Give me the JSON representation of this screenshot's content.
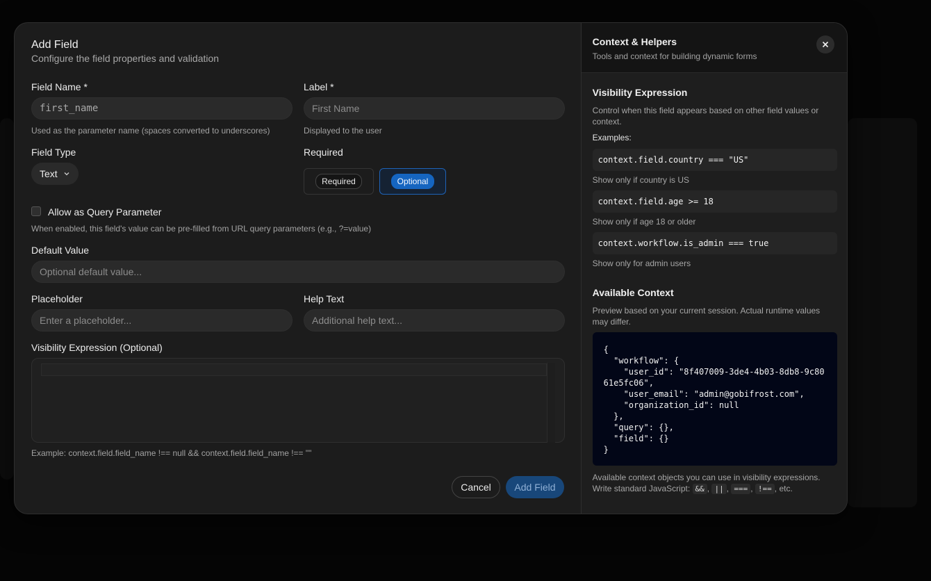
{
  "form": {
    "title": "Add Field",
    "subtitle": "Configure the field properties and validation",
    "field_name": {
      "label": "Field Name *",
      "value": "first_name",
      "hint": "Used as the parameter name (spaces converted to underscores)"
    },
    "label_field": {
      "label": "Label *",
      "placeholder": "First Name",
      "hint": "Displayed to the user"
    },
    "field_type": {
      "label": "Field Type",
      "value": "Text"
    },
    "required": {
      "label": "Required",
      "options": [
        "Required",
        "Optional"
      ],
      "selected": "Optional"
    },
    "query_param": {
      "label": "Allow as Query Parameter",
      "checked": false,
      "hint": "When enabled, this field's value can be pre-filled from URL query parameters (e.g., ?=value)"
    },
    "default_value": {
      "label": "Default Value",
      "placeholder": "Optional default value..."
    },
    "placeholder_field": {
      "label": "Placeholder",
      "placeholder": "Enter a placeholder..."
    },
    "help_text": {
      "label": "Help Text",
      "placeholder": "Additional help text..."
    },
    "visibility": {
      "label": "Visibility Expression (Optional)",
      "example": "Example: context.field.field_name !== null && context.field.field_name !== \"\""
    },
    "buttons": {
      "cancel": "Cancel",
      "submit": "Add Field"
    }
  },
  "helpers": {
    "title": "Context & Helpers",
    "subtitle": "Tools and context for building dynamic forms",
    "visibility": {
      "title": "Visibility Expression",
      "description": "Control when this field appears based on other field values or context.",
      "examples_label": "Examples:",
      "examples": [
        {
          "code": "context.field.country === \"US\"",
          "caption": "Show only if country is US"
        },
        {
          "code": "context.field.age >= 18",
          "caption": "Show only if age 18 or older"
        },
        {
          "code": "context.workflow.is_admin === true",
          "caption": "Show only for admin users"
        }
      ]
    },
    "context": {
      "title": "Available Context",
      "description": "Preview based on your current session. Actual runtime values may differ.",
      "json": "{\n  \"workflow\": {\n    \"user_id\": \"8f407009-3de4-4b03-8db8-9c8061e5fc06\",\n    \"user_email\": \"admin@gobifrost.com\",\n    \"organization_id\": null\n  },\n  \"query\": {},\n  \"field\": {}\n}",
      "footer_1": "Available context objects you can use in visibility expressions.",
      "footer_2": "Write standard JavaScript:",
      "operators": [
        "&&",
        "||",
        "===",
        "!=="
      ],
      "footer_end": ", etc."
    }
  },
  "colors": {
    "accent": "#1565c0",
    "modal_bg": "#1c1c1c",
    "json_bg": "#020617"
  },
  "icons": {
    "close": "close-icon",
    "chevron": "chevron-down-icon"
  }
}
